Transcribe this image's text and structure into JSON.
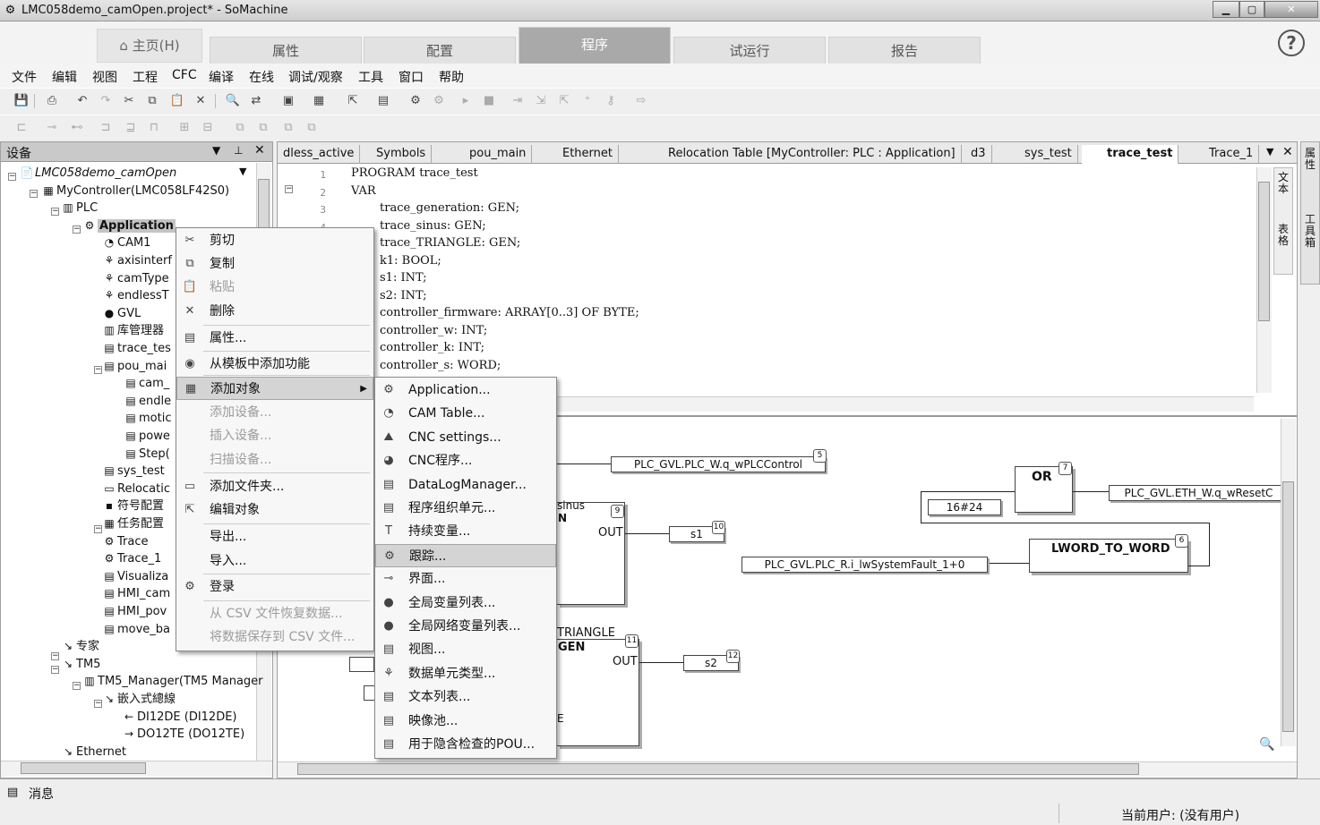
{
  "window": {
    "title": "LMC058demo_camOpen.project* - SoMachine",
    "app_icon": "gear-icon"
  },
  "ribbon": {
    "home": "主页(H)",
    "tabs": [
      "属性",
      "配置",
      "程序",
      "试运行",
      "报告"
    ],
    "active": "程序",
    "help": "?"
  },
  "menubar": [
    "文件",
    "编辑",
    "视图",
    "工程",
    "CFC",
    "编译",
    "在线",
    "调试/观察",
    "工具",
    "窗口",
    "帮助"
  ],
  "devices": {
    "header": "设备",
    "tree": [
      {
        "label": "LMC058demo_camOpen",
        "italic": true
      },
      {
        "label": "MyController(LMC058LF42S0)"
      },
      {
        "label": "PLC"
      },
      {
        "label": "Application",
        "selected": true
      },
      {
        "label": "CAM1"
      },
      {
        "label": "axisinterf"
      },
      {
        "label": "camType"
      },
      {
        "label": "endlessT"
      },
      {
        "label": "GVL"
      },
      {
        "label": "库管理器"
      },
      {
        "label": "trace_tes"
      },
      {
        "label": "pou_mai"
      },
      {
        "label": "cam_"
      },
      {
        "label": "endle"
      },
      {
        "label": "motic"
      },
      {
        "label": "powe"
      },
      {
        "label": "Step("
      },
      {
        "label": "sys_test"
      },
      {
        "label": "Relocatic"
      },
      {
        "label": "符号配置"
      },
      {
        "label": "任务配置"
      },
      {
        "label": "Trace"
      },
      {
        "label": "Trace_1"
      },
      {
        "label": "Visualiza"
      },
      {
        "label": "HMI_cam"
      },
      {
        "label": "HMI_pov"
      },
      {
        "label": "move_ba"
      },
      {
        "label": "专家"
      },
      {
        "label": "TM5"
      },
      {
        "label": "TM5_Manager(TM5 Manager"
      },
      {
        "label": "嵌入式總線"
      },
      {
        "label": "DI12DE (DI12DE)"
      },
      {
        "label": "DO12TE (DO12TE)"
      },
      {
        "label": "Ethernet"
      }
    ]
  },
  "doctabs": [
    "dless_active",
    "Symbols",
    "pou_main",
    "Ethernet",
    "Relocation Table [MyController: PLC : Application]",
    "d3",
    "sys_test",
    "trace_test",
    "Trace_1"
  ],
  "active_doctab": "trace_test",
  "code": {
    "line_numbers": [
      "1",
      "2",
      "3",
      "4"
    ],
    "lines": [
      "PROGRAM trace_test",
      "VAR",
      "trace_generation: GEN;",
      "trace_sinus: GEN;",
      "trace_TRIANGLE: GEN;",
      "k1: BOOL;",
      "s1: INT;",
      "s2: INT;",
      "controller_firmware: ARRAY[0..3] OF BYTE;",
      "controller_w: INT;",
      "controller_k: INT;",
      "controller_s: WORD;"
    ]
  },
  "graph": {
    "out1": "PLC_GVL.PLC_W.q_wPLCControl",
    "n5": "5",
    "or": "OR",
    "n7": "7",
    "const": "16#24",
    "reset": "PLC_GVL.ETH_W.q_wResetC",
    "sinus": "sinus",
    "gen_n": "N",
    "n9": "9",
    "out": "OUT",
    "s1": "s1",
    "n10": "10",
    "lword": "LWORD_TO_WORD",
    "n6": "6",
    "sysfault": "PLC_GVL.PLC_R.i_lwSystemFault_1+0",
    "triangle": "TRIANGLE",
    "gen": "GEN",
    "n11": "11",
    "out2": "OUT",
    "s2": "s2",
    "n12": "12",
    "e": "E"
  },
  "context_menu": [
    {
      "label": "剪切",
      "icon": "scissors-icon"
    },
    {
      "label": "复制",
      "icon": "copy-icon"
    },
    {
      "label": "粘贴",
      "icon": "paste-icon",
      "disabled": true
    },
    {
      "label": "删除",
      "icon": "delete-icon"
    },
    {
      "label": "属性...",
      "icon": "properties-icon"
    },
    {
      "label": "从模板中添加功能",
      "icon": "template-icon"
    },
    {
      "label": "添加对象",
      "icon": "add-object-icon",
      "submenu": true,
      "highlight": true
    },
    {
      "label": "添加设备...",
      "disabled": true
    },
    {
      "label": "插入设备...",
      "disabled": true
    },
    {
      "label": "扫描设备...",
      "disabled": true
    },
    {
      "label": "添加文件夹...",
      "icon": "folder-icon"
    },
    {
      "label": "编辑对象",
      "icon": "edit-icon"
    },
    {
      "label": "导出..."
    },
    {
      "label": "导入..."
    },
    {
      "label": "登录",
      "icon": "login-icon"
    },
    {
      "label": "从 CSV 文件恢复数据...",
      "disabled": true
    },
    {
      "label": "将数据保存到 CSV 文件...",
      "disabled": true
    }
  ],
  "submenu": [
    {
      "label": "Application...",
      "icon": "gear-icon"
    },
    {
      "label": "CAM Table...",
      "icon": "cam-icon"
    },
    {
      "label": "CNC settings...",
      "icon": "cnc-icon"
    },
    {
      "label": "CNC程序...",
      "icon": "cnc-program-icon"
    },
    {
      "label": "DataLogManager...",
      "icon": "datalog-icon"
    },
    {
      "label": "程序组织单元...",
      "icon": "pou-icon"
    },
    {
      "label": "持续变量...",
      "icon": "persistent-icon"
    },
    {
      "label": "跟踪...",
      "icon": "trace-icon",
      "highlight": true
    },
    {
      "label": "界面...",
      "icon": "interface-icon"
    },
    {
      "label": "全局变量列表...",
      "icon": "gvl-icon"
    },
    {
      "label": "全局网络变量列表...",
      "icon": "network-gvl-icon"
    },
    {
      "label": "视图...",
      "icon": "view-icon"
    },
    {
      "label": "数据单元类型...",
      "icon": "dut-icon"
    },
    {
      "label": "文本列表...",
      "icon": "textlist-icon"
    },
    {
      "label": "映像池...",
      "icon": "imagepool-icon"
    },
    {
      "label": "用于隐含检查的POU...",
      "icon": "check-pou-icon"
    }
  ],
  "status": {
    "messages": "消息",
    "user": "当前用户: (没有用户)"
  },
  "right_sidebar": {
    "tab1": "属性",
    "tab2": "工具箱"
  },
  "editor_side": {
    "t1": "文本",
    "t2": "表格"
  }
}
